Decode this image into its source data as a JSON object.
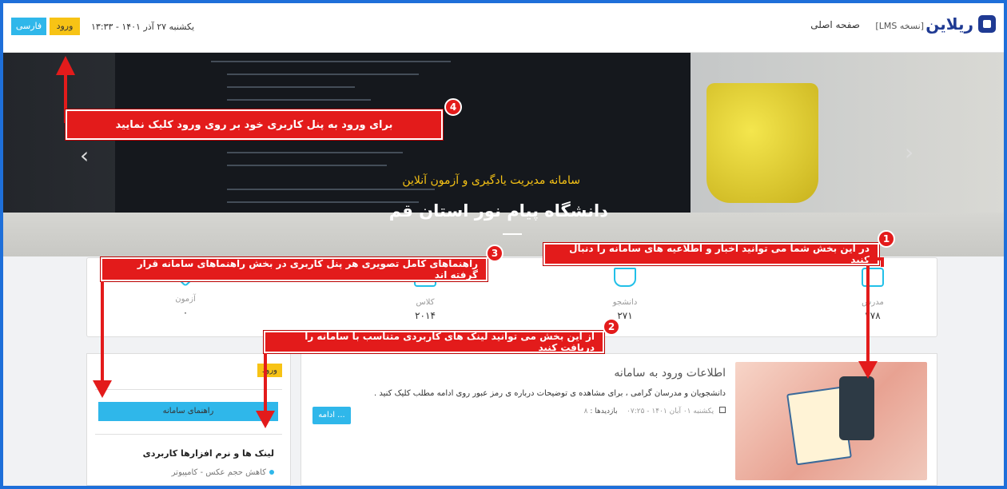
{
  "header": {
    "logo_text": "ریلاین",
    "version_label": "[نسخه LMS]",
    "home_link": "صفحه اصلی",
    "datetime": "یکشنبه ۲۷ آذر ۱۴۰۱ - ۱۳:۳۳",
    "login_button": "ورود",
    "language_button": "فارسی"
  },
  "hero": {
    "subtitle": "سامانه مدیریت یادگیری و آزمون آنلاین",
    "title": "دانشگاه پیام نور استان قم",
    "prev_arrow": "‹",
    "next_arrow": "›"
  },
  "stats": [
    {
      "label": "مدرس",
      "value": "۲۷۸"
    },
    {
      "label": "دانشجو",
      "value": "۲۷۱"
    },
    {
      "label": "کلاس",
      "value": "۲۰۱۴"
    },
    {
      "label": "آزمون",
      "value": "۰"
    }
  ],
  "sidebar": {
    "badge": "ورود",
    "guide_button": "راهنمای سامانه",
    "links_heading": "لینک ها و نرم افزارها کاربردی",
    "link_item": "کاهش حجم عکس - کامپیوتر"
  },
  "post": {
    "title": "اطلاعات ورود به سامانه",
    "text": "دانشجویان و مدرسان گرامی ، برای مشاهده ی توضیحات درباره ی رمز عبور روی ادامه مطلب کلیک کنید .",
    "date": "یکشنبه ۰۱ آبان ۱۴۰۱ - ۰۷:۲۵",
    "views_label": "بازدیدها :",
    "views_value": "۸",
    "more_button": "ادامه ..."
  },
  "annotations": [
    {
      "num": "4",
      "text": "برای ورود به پنل کاربری خود بر روی ورود کلیک نمایید"
    },
    {
      "num": "1",
      "text": "در این بخش شما می توانید اخبار و اطلاعیه های سامانه را دنبال کنید"
    },
    {
      "num": "3",
      "text": "راهنماهای کامل تصویری هر پنل کاربری در بخش راهنماهای سامانه قرار گرفته اند"
    },
    {
      "num": "2",
      "text": "از این بخش می توانید لینک های کاربردی متناسب با سامانه را دریافت کنید"
    }
  ],
  "colors": {
    "accent_blue": "#2fb7ea",
    "accent_yellow": "#f7c315",
    "annotation_red": "#e31b1b",
    "border_blue": "#1e6fd9"
  }
}
